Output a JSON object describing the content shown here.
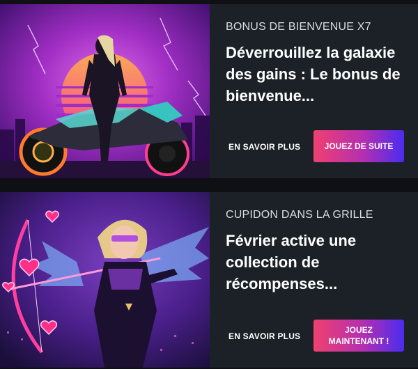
{
  "promos": [
    {
      "category": "BONUS DE BIENVENUE X7",
      "headline": "Déverrouillez la galaxie des gains : Le bonus de bienvenue...",
      "learn_more": "EN SAVOIR PLUS",
      "cta": "JOUEZ DE SUITE",
      "image": "cyberpunk-rider-motorcycle-image"
    },
    {
      "category": "CUPIDON DANS LA GRILLE",
      "headline": "Février active une collection de récompenses...",
      "learn_more": "EN SAVOIR PLUS",
      "cta": "JOUEZ MAINTENANT !",
      "image": "cupid-archer-heroine-image"
    }
  ],
  "colors": {
    "card_bg": "#1c2127",
    "page_bg": "#0e1014",
    "cta_gradient": [
      "#f0406f",
      "#b42fb0",
      "#4a2cf0"
    ]
  }
}
